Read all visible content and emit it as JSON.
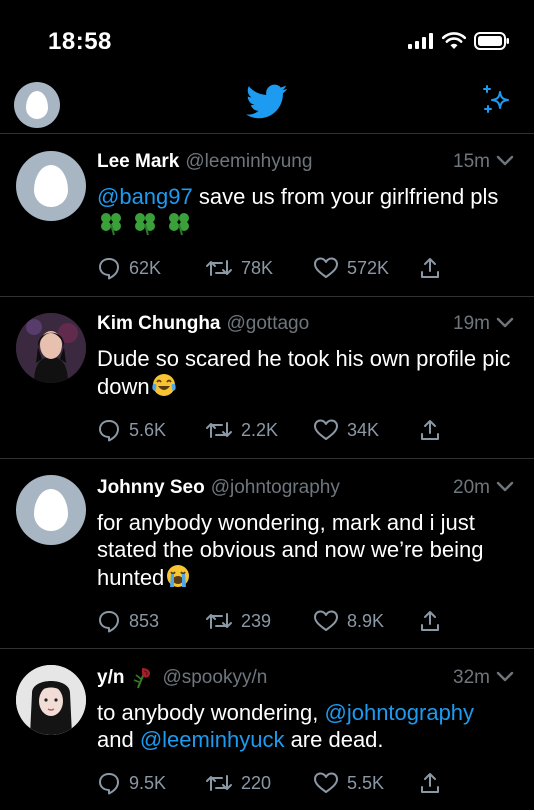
{
  "status_bar": {
    "time": "18:58"
  },
  "header": {
    "avatar_icon": "default-egg-avatar-icon",
    "logo_icon": "twitter-bird-icon",
    "right_icon": "sparkle-icon",
    "brand_color": "#1d9bf0"
  },
  "tweets": [
    {
      "name": "Lee Mark",
      "handle": "@leeminhyung",
      "time": "15m",
      "body_parts": [
        {
          "text": "@bang97",
          "type": "mention"
        },
        {
          "text": " save us from your girlfriend pls",
          "type": "text"
        }
      ],
      "emoji": [
        "four-leaf-clover",
        "four-leaf-clover",
        "four-leaf-clover"
      ],
      "replies": "62K",
      "retweets": "78K",
      "likes": "572K"
    },
    {
      "name": "Kim Chungha",
      "handle": "@gottago",
      "time": "19m",
      "body_parts": [
        {
          "text": "Dude so scared he took his own profile pic down",
          "type": "text"
        }
      ],
      "emoji": [
        "face-with-tears-of-joy"
      ],
      "replies": "5.6K",
      "retweets": "2.2K",
      "likes": "34K"
    },
    {
      "name": "Johnny Seo",
      "handle": "@johntography",
      "time": "20m",
      "body_parts": [
        {
          "text": "for anybody wondering, mark and i just stated the obvious and now we’re being hunted",
          "type": "text"
        }
      ],
      "emoji": [
        "loudly-crying-face"
      ],
      "replies": "853",
      "retweets": "239",
      "likes": "8.9K"
    },
    {
      "name": "y/n",
      "handle": "@spookyy/n",
      "time": "32m",
      "body_parts": [
        {
          "text": "to anybody wondering, ",
          "type": "text"
        },
        {
          "text": "@johntography",
          "type": "mention"
        },
        {
          "text": " and ",
          "type": "text"
        },
        {
          "text": "@leeminhyuck",
          "type": "mention"
        },
        {
          "text": " are dead.",
          "type": "text"
        }
      ],
      "emoji": [],
      "flair_emoji": "wilted-rose",
      "replies": "9.5K",
      "retweets": "220",
      "likes": "5.5K"
    }
  ]
}
